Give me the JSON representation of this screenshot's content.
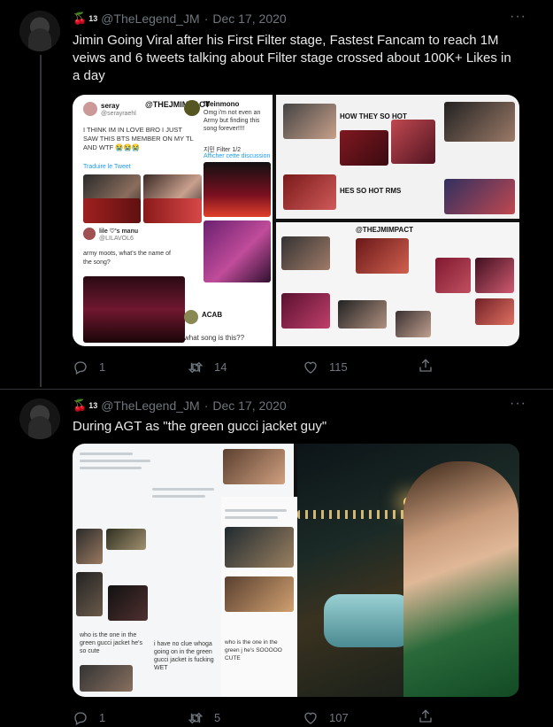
{
  "tweets": [
    {
      "emoji": "🍒",
      "sup": "13",
      "handle": "@TheLegend_JM",
      "sep": "·",
      "date": "Dec 17, 2020",
      "text": "Jimin Going Viral after his First Filter stage, Fastest Fancam to reach 1M veiws and 6 tweets talking about Filter stage crossed about 100K+ Likes in a day",
      "replies": "1",
      "retweets": "14",
      "likes": "115",
      "media": {
        "seray_name": "seray",
        "seray_handle": "@serayraehl",
        "impact": "@THEJMIMPACT",
        "tweet1": "I THINK IM IN LOVE BRO I JUST SAW THIS BTS MEMBER ON MY TL AND WTF 😭😭😭",
        "translate": "Traduire le Tweet",
        "lifeinmono": "lifeinmono",
        "lifeinmono_text": "Omg i'm not even an Army but finding this song forever!!!!",
        "filter": "지민 Filter 1/2",
        "afficher": "Afficher cette discussion",
        "lile": "lile ♡'s manu",
        "lile_handle": "@LILAVOL6",
        "army": "army moots, what's the name of the song?",
        "acab": "ACAB",
        "what_song": "what song is this??",
        "how_hot": "HOW THEY SO HOT",
        "hes_so_hot": "HES SO HOT RMS"
      }
    },
    {
      "emoji": "🍒",
      "sup": "13",
      "handle": "@TheLegend_JM",
      "sep": "·",
      "date": "Dec 17, 2020",
      "text": "During AGT as \"the green gucci jacket guy\"",
      "replies": "1",
      "retweets": "5",
      "likes": "107",
      "media": {
        "green_jacket": "who is the one in the green gucci jacket he's so cute",
        "wtf": "i have no clue whoga going on in the green gucci jacket is fucking WET",
        "soooo": "who is the one in the green j he's SOOOOO CUTE"
      }
    }
  ],
  "more_icon": "more-horizontal-icon",
  "colors": {
    "bg": "#000000",
    "muted": "#6e767d",
    "text": "#e7e9ea"
  }
}
